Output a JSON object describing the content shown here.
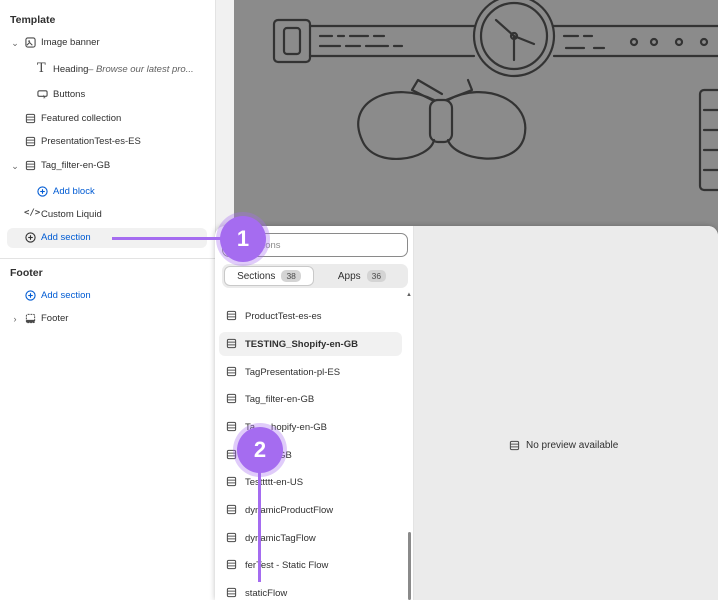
{
  "sidebar": {
    "template_title": "Template",
    "items": [
      {
        "label": "Image banner",
        "icon": "image-icon"
      },
      {
        "label": "Heading",
        "sublabel": "Browse our latest pro...",
        "icon": "text-icon"
      },
      {
        "label": "Buttons",
        "icon": "button-icon"
      },
      {
        "label": "Featured collection",
        "icon": "section-icon"
      },
      {
        "label": "PresentationTest-es-ES",
        "icon": "section-icon"
      },
      {
        "label": "Tag_filter-en-GB",
        "icon": "section-icon"
      },
      {
        "label": "Add block",
        "icon": "plus-circle-icon"
      },
      {
        "label": "Custom Liquid",
        "icon": "code-icon"
      },
      {
        "label": "Add section",
        "icon": "plus-circle-icon"
      }
    ],
    "footer_title": "Footer",
    "footer_items": [
      {
        "label": "Add section",
        "icon": "plus-circle-icon"
      },
      {
        "label": "Footer",
        "icon": "footer-icon"
      }
    ]
  },
  "picker": {
    "search_placeholder": "Search sections",
    "search_visible_text": "ch sections",
    "tabs": [
      {
        "label": "Sections",
        "count": "38"
      },
      {
        "label": "Apps",
        "count": "36"
      }
    ],
    "items": [
      "ProductTest-es-es",
      "TESTING_Shopify-en-GB",
      "TagPresentation-pl-ES",
      "Tag_filter-en-GB",
      "Tag_shopify-en-GB",
      "Test-en-GB",
      "Testtttt-en-US",
      "dynamicProductFlow",
      "dynamicTagFlow",
      "ferTest - Static Flow",
      "staticFlow"
    ],
    "items_visible": [
      "ProductTest-es-es",
      "TESTING_Shopify-en-GB",
      "TagPresentation-pl-ES",
      "Tag_filter-en-GB",
      "Ta",
      "hopify-en-GB",
      "-GB",
      "Testtttt-en-US",
      "dynamicProductFlow",
      "dynamicTagFlow",
      "ferTest - Static Flow",
      "staticFlow"
    ],
    "no_preview": "No preview available"
  },
  "callouts": [
    "1",
    "2"
  ],
  "colors": {
    "accent": "#a56cf0",
    "link": "#005bd3",
    "preview_bg": "#8b8b8b"
  }
}
